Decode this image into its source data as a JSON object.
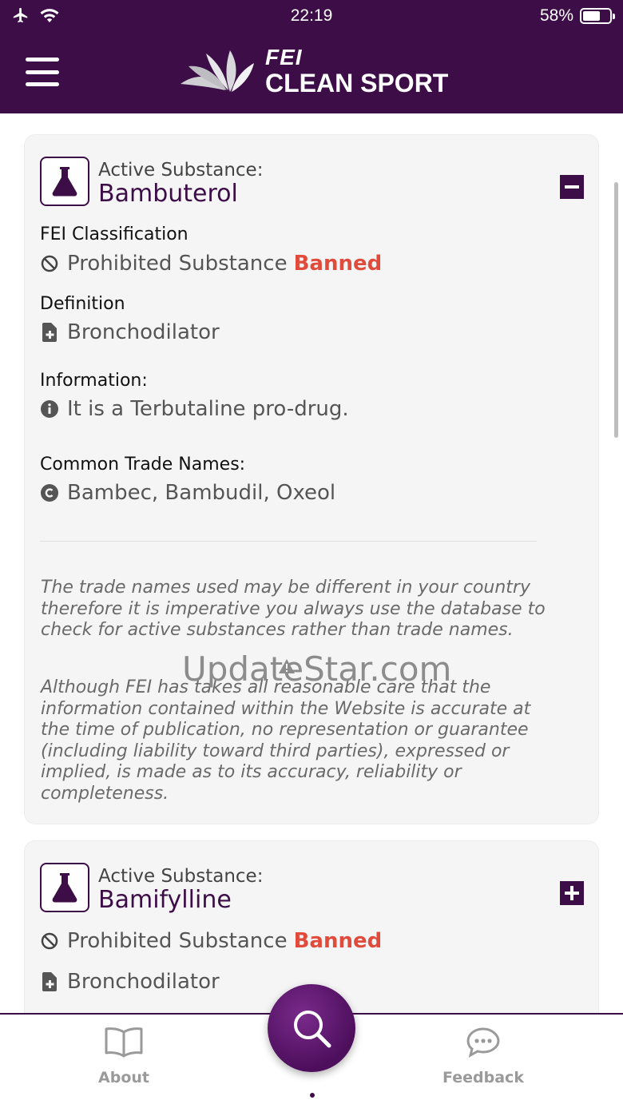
{
  "status_bar": {
    "time": "22:19",
    "battery": "58%",
    "battery_level": 0.58
  },
  "header": {
    "logo_top": "FEI",
    "logo_bottom": "CLEAN SPORT"
  },
  "substances": [
    {
      "label": "Active Substance:",
      "name": "Bambuterol",
      "toggle": "−",
      "classification_heading": "FEI Classification",
      "classification": "Prohibited Substance",
      "status": "Banned",
      "definition_heading": "Definition",
      "definition": "Bronchodilator",
      "information_heading": "Information:",
      "information": "It is a Terbutaline pro-drug.",
      "trade_heading": "Common Trade Names:",
      "trade_names": "Bambec, Bambudil, Oxeol",
      "note1": "The trade names used may be different in your country therefore it is imperative you always use the database to check for active substances rather than trade names.",
      "note2": "Although FEI has takes all reasonable care that the information contained within the Website is accurate at the time of publication, no representation or guarantee (including liability toward third parties), expressed or implied, is made as to its accuracy, reliability or completeness."
    },
    {
      "label": "Active Substance:",
      "name": "Bamifylline",
      "toggle": "+",
      "classification": "Prohibited Substance",
      "status": "Banned",
      "definition": "Bronchodilator"
    }
  ],
  "watermark": "UpdateStar.com",
  "tabs": {
    "about": "About",
    "feedback": "Feedback"
  },
  "colors": {
    "brand": "#3d0d47",
    "banned": "#e14b3b"
  },
  "icons": [
    "airplane-icon",
    "wifi-icon",
    "menu-icon",
    "flask-icon",
    "minus-icon",
    "plus-icon",
    "prohibited-icon",
    "document-plus-icon",
    "info-icon",
    "copyright-icon",
    "search-icon",
    "book-icon",
    "chat-icon"
  ]
}
